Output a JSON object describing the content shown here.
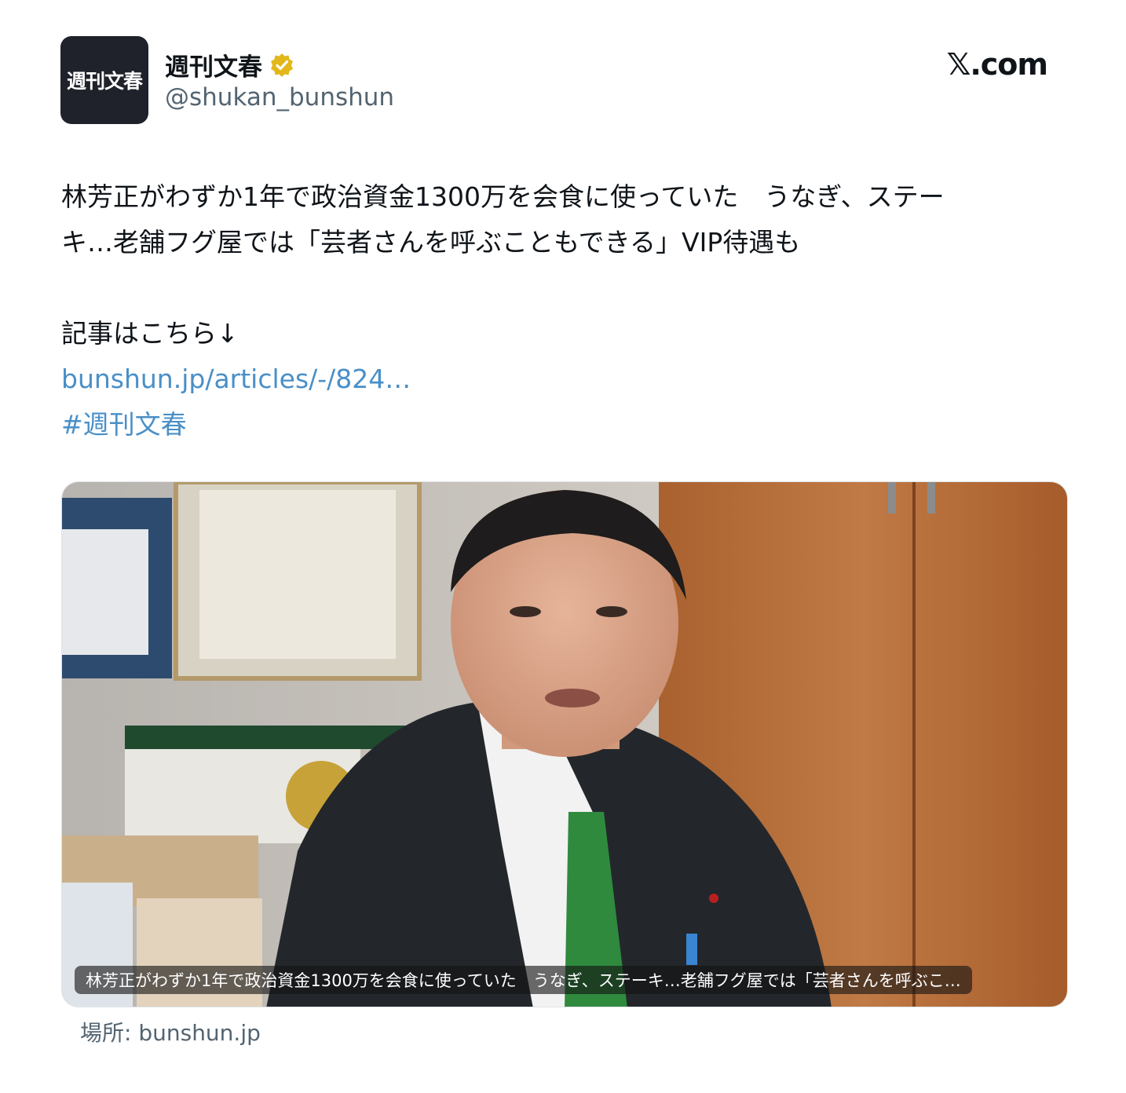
{
  "account": {
    "avatar_text": "週刊文春",
    "name": "週刊文春",
    "handle": "@shukan_bunshun"
  },
  "brand": "𝕏.com",
  "tweet": {
    "line1": "林芳正がわずか1年で政治資金1300万を会食に使っていた　うなぎ、ステー",
    "line2": "キ…老舗フグ屋では「芸者さんを呼ぶこともできる」VIP待遇も",
    "line3": "記事はこちら↓",
    "link": "bunshun.jp/articles/-/824…",
    "hashtag": "#週刊文春"
  },
  "media": {
    "caption": "林芳正がわずか1年で政治資金1300万を会食に使っていた　うなぎ、ステーキ…老舗フグ屋では「芸者さんを呼ぶこ…",
    "source": "場所: bunshun.jp"
  },
  "colors": {
    "link": "#4a8fc7",
    "verified": "#e2b719",
    "avatar_bg": "#1f222a"
  }
}
